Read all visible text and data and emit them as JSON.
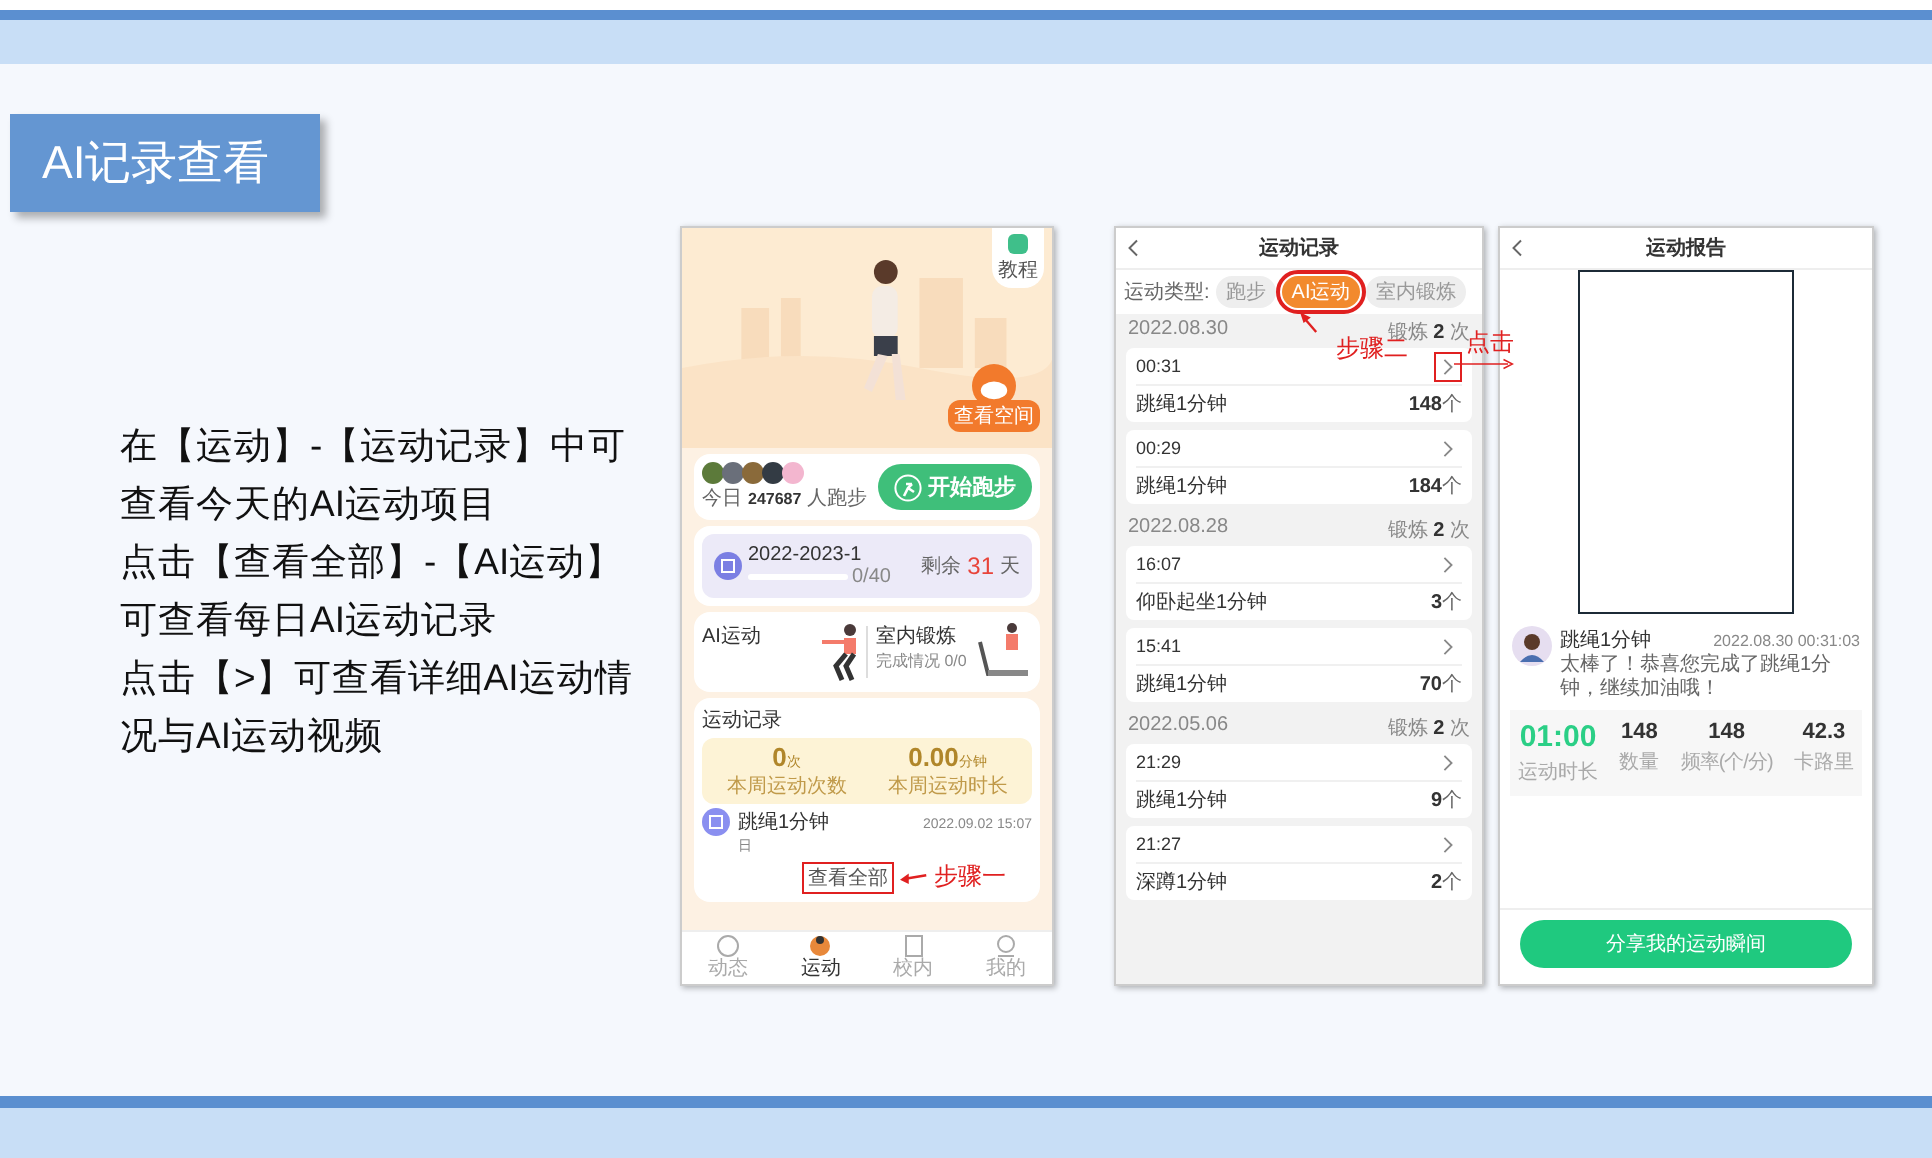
{
  "slide": {
    "title": "AI记录查看",
    "description": [
      "在【运动】-【运动记录】中可",
      "查看今天的AI运动项目",
      "点击【查看全部】-【AI运动】",
      "可查看每日AI运动记录",
      "点击【>】可查看详细AI运动情",
      "况与AI运动视频"
    ]
  },
  "phone_home": {
    "tutorial": "教程",
    "space_badge": "查看空间",
    "today_label": "今日",
    "today_count": "247687",
    "today_suffix": "人跑步",
    "start_button": "开始跑步",
    "term": {
      "name": "2022-2023-1",
      "progress": "0/40",
      "level": 0,
      "remain_label": "剩余",
      "remain_days": "31",
      "remain_unit": "天"
    },
    "ai_sport": "AI运动",
    "indoor": {
      "title": "室内锻炼",
      "status": "完成情况 0/0"
    },
    "records": {
      "title": "运动记录",
      "stats": [
        {
          "value": "0",
          "unit": "次",
          "label": "本周运动次数"
        },
        {
          "value": "0.00",
          "unit": "分钟",
          "label": "本周运动时长"
        }
      ],
      "latest": {
        "name": "跳绳1分钟",
        "date": "2022.09.02 15:07",
        "note": "日"
      },
      "view_all": {
        "label": "查看全部",
        "highlighted": true
      }
    },
    "step_note": "步骤一",
    "tabs": [
      {
        "label": "动态",
        "selected": false
      },
      {
        "label": "运动",
        "selected": true
      },
      {
        "label": "校内",
        "selected": false
      },
      {
        "label": "我的",
        "selected": false
      }
    ]
  },
  "phone_records": {
    "title": "运动记录",
    "filter_label": "运动类型:",
    "filters": [
      {
        "label": "跑步",
        "selected": false,
        "highlighted": false
      },
      {
        "label": "AI运动",
        "selected": true,
        "highlighted": true
      },
      {
        "label": "室内锻炼",
        "selected": false,
        "highlighted": false
      }
    ],
    "groups": [
      {
        "date": "2022.08.30",
        "summary": "锻炼 **2** 次",
        "records": [
          {
            "time": "00:31",
            "name": "跳绳1分钟",
            "value": "148",
            "unit": "个",
            "highlighted": true
          },
          {
            "time": "00:29",
            "name": "跳绳1分钟",
            "value": "184",
            "unit": "个",
            "highlighted": false
          }
        ]
      },
      {
        "date": "2022.08.28",
        "summary": "锻炼 **2** 次",
        "records": [
          {
            "time": "16:07",
            "name": "仰卧起坐1分钟",
            "value": "3",
            "unit": "个",
            "highlighted": false
          },
          {
            "time": "15:41",
            "name": "跳绳1分钟",
            "value": "70",
            "unit": "个",
            "highlighted": false
          }
        ]
      },
      {
        "date": "2022.05.06",
        "summary": "锻炼 **2** 次",
        "records": [
          {
            "time": "21:29",
            "name": "跳绳1分钟",
            "value": "9",
            "unit": "个",
            "highlighted": false
          },
          {
            "time": "21:27",
            "name": "深蹲1分钟",
            "value": "2",
            "unit": "个",
            "highlighted": false
          }
        ]
      }
    ],
    "step_note": "步骤二",
    "click_note": "点击"
  },
  "phone_report": {
    "title": "运动报告",
    "user": {
      "name": "跳绳1分钟",
      "time": "2022.08.30 00:31:03",
      "message": "太棒了！恭喜您完成了跳绳1分钟，继续加油哦！"
    },
    "stats": [
      {
        "value": "01:00",
        "label": "运动时长",
        "kind": "primary"
      },
      {
        "value": "148",
        "label": "数量",
        "kind": "plain"
      },
      {
        "value": "148",
        "label": "频率(个/分)",
        "kind": "plain"
      },
      {
        "value": "42.3",
        "label": "卡路里",
        "kind": "plain"
      }
    ],
    "share_button": "分享我的运动瞬间"
  }
}
